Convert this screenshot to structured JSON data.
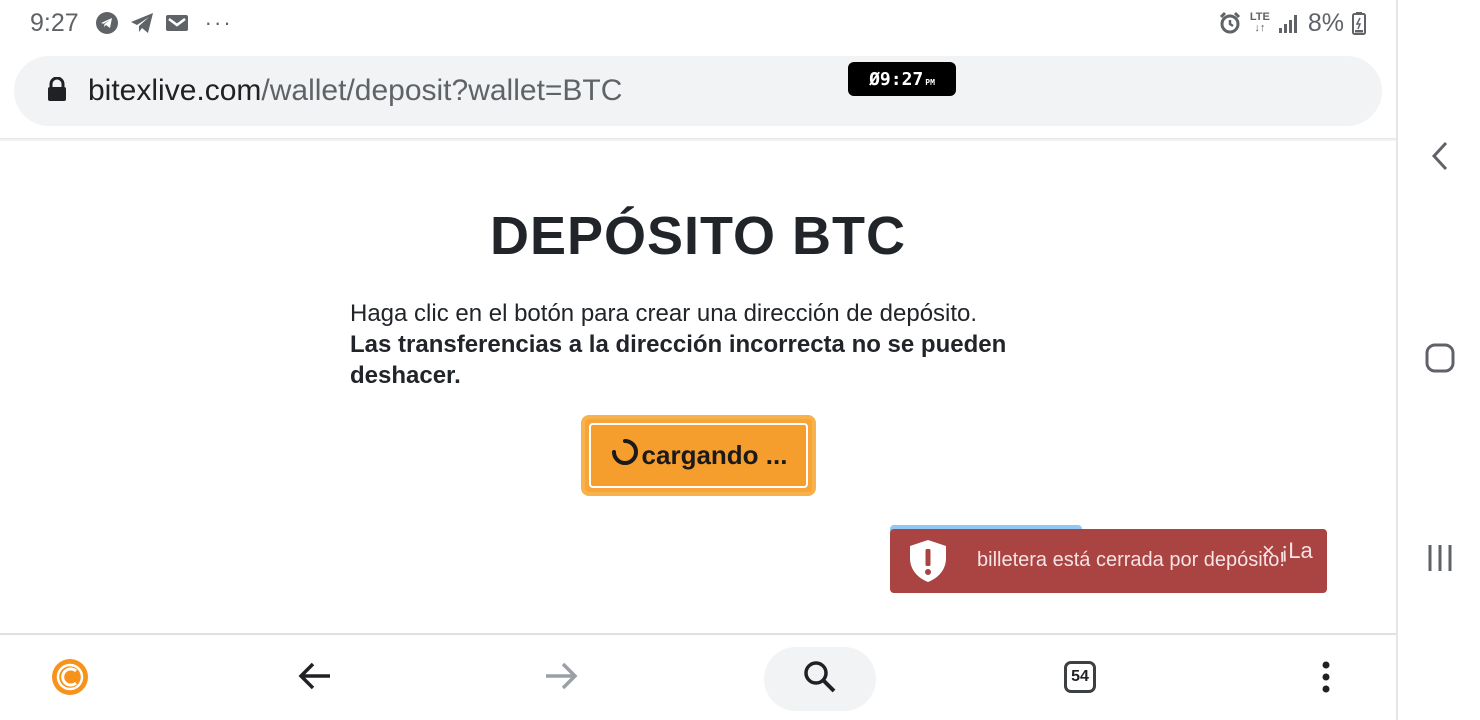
{
  "status_bar": {
    "time": "9:27",
    "notification_icons": [
      "telegram-icon",
      "telegram-plane-icon",
      "gmail-icon"
    ],
    "more": "···",
    "right_icons": [
      "alarm-icon",
      "lte-icon",
      "signal-icon"
    ],
    "lte_label": "LTE",
    "battery": "8%"
  },
  "browser": {
    "url_domain": "bitexlive.com",
    "url_path": "/wallet/deposit?wallet=BTC",
    "overlay_clock": "Ø9:27",
    "overlay_clock_ampm": "PM"
  },
  "page": {
    "title": "DEPÓSITO BTC",
    "instruction": "Haga clic en el botón para crear una dirección de depósito.",
    "warning": "Las transferencias a la dirección incorrecta no se pueden deshacer.",
    "button_label": "cargando ..."
  },
  "toast": {
    "message": "billetera está cerrada por depósito!",
    "close": "× ¡La",
    "accent": "#a94442",
    "progress_color": "#8fc8f4"
  },
  "bottom_bar": {
    "tabs_count": "54"
  },
  "colors": {
    "button": "#f59e2e",
    "coin": "#f7931a"
  }
}
